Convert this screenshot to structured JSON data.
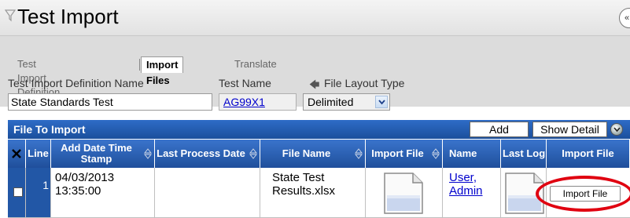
{
  "header": {
    "title": "Test Import",
    "filter_icon": "funnel-icon",
    "collapse_glyph": "«"
  },
  "tabs": [
    {
      "label": "Test Import Definition",
      "active": false
    },
    {
      "label": "Import Files",
      "active": true
    },
    {
      "label": "Translate",
      "active": false
    }
  ],
  "fields": {
    "definition_name_label": "Test Import Definition Name",
    "test_name_label": "Test Name",
    "file_layout_label": "File Layout Type",
    "definition_name_value": "State Standards Test",
    "test_name_value": "AG99X1",
    "file_layout_value": "Delimited"
  },
  "section": {
    "title": "File To Import",
    "add_label": "Add",
    "show_detail_label": "Show Detail"
  },
  "grid": {
    "columns": [
      "Line",
      "Add Date Time Stamp",
      "Last Process Date",
      "File Name",
      "Import File",
      "Name",
      "Last Log",
      "Import File"
    ],
    "rows": [
      {
        "line": "1",
        "add_date": "04/03/2013",
        "add_time": "13:35:00",
        "last_process_date": "",
        "file_name_line1": "State Test",
        "file_name_line2": "Results.xlsx",
        "name_line1": "User,",
        "name_line2": "Admin",
        "import_button": "Import File"
      }
    ]
  },
  "colors": {
    "header_blue": "#1e4e9a",
    "annotation_red": "#e00010",
    "link": "#0000cc"
  }
}
